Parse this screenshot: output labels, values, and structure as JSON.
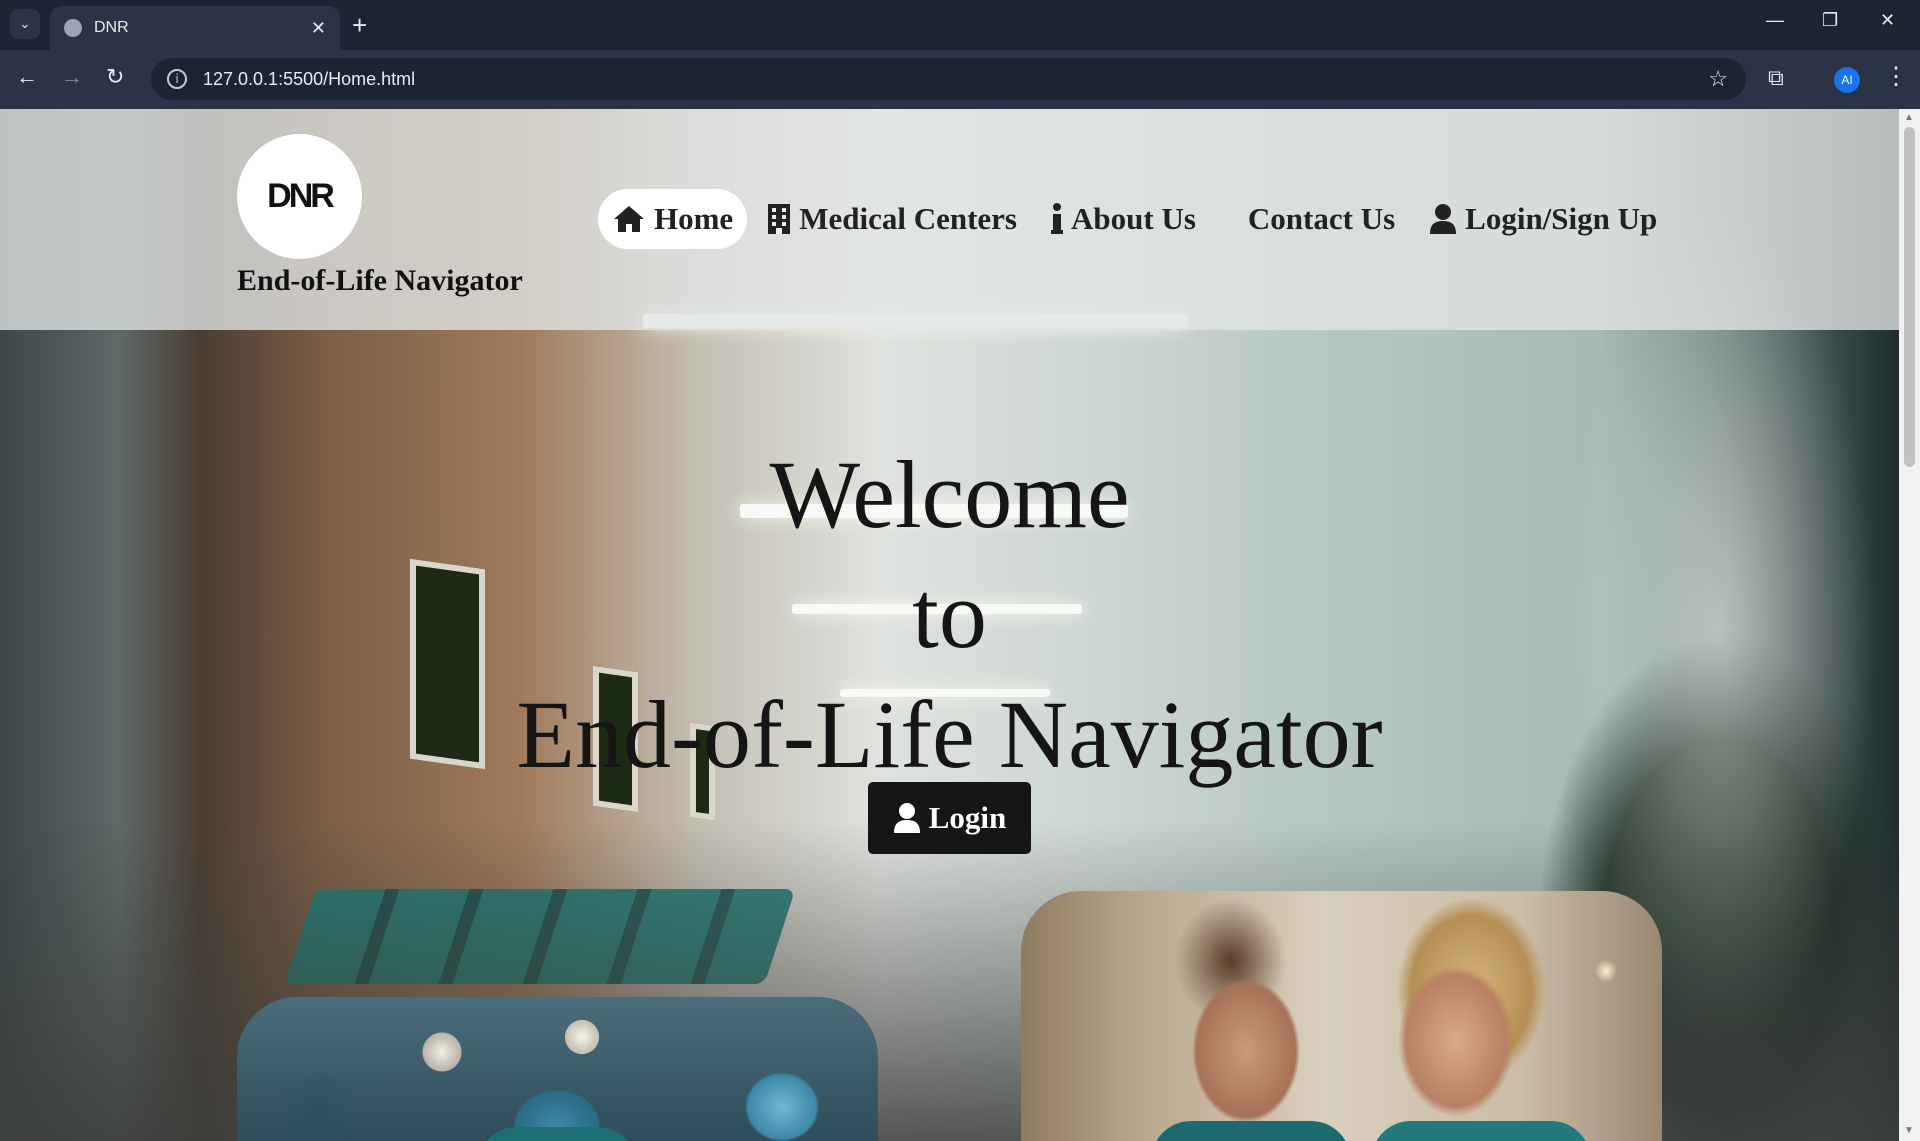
{
  "browser": {
    "tab_title": "DNR",
    "url": "127.0.0.1:5500/Home.html",
    "profile_initials": "AI",
    "icons": {
      "tab_dropdown": "chevron-down-icon",
      "favicon": "globe-icon",
      "tab_close": "close-icon",
      "new_tab": "plus-icon",
      "back": "arrow-left-icon",
      "forward": "arrow-right-icon",
      "reload": "reload-icon",
      "site_info": "info-icon",
      "bookmark": "star-icon",
      "extensions": "puzzle-icon",
      "menu": "kebab-menu-icon",
      "minimize": "minimize-icon",
      "restore": "restore-icon",
      "close_window": "close-icon"
    }
  },
  "site": {
    "logo_text": "DNR",
    "name": "End-of-Life Navigator",
    "nav": [
      {
        "label": "Home",
        "icon": "home-icon",
        "active": true
      },
      {
        "label": "Medical Centers",
        "icon": "building-icon",
        "active": false
      },
      {
        "label": "About Us",
        "icon": "info-icon",
        "active": false
      },
      {
        "label": "Contact Us",
        "icon": "",
        "active": false
      },
      {
        "label": "Login/Sign Up",
        "icon": "user-icon",
        "active": false
      }
    ]
  },
  "hero": {
    "line1": "Welcome",
    "line2": "to",
    "line3": "End-of-Life Navigator",
    "login_label": "Login",
    "login_icon": "user-icon"
  },
  "colors": {
    "browser_dark": "#1b2433",
    "browser_toolbar": "#2a3446",
    "header_bg": "#e2e6e6",
    "button_bg": "#161616",
    "text_dark": "#151515"
  }
}
